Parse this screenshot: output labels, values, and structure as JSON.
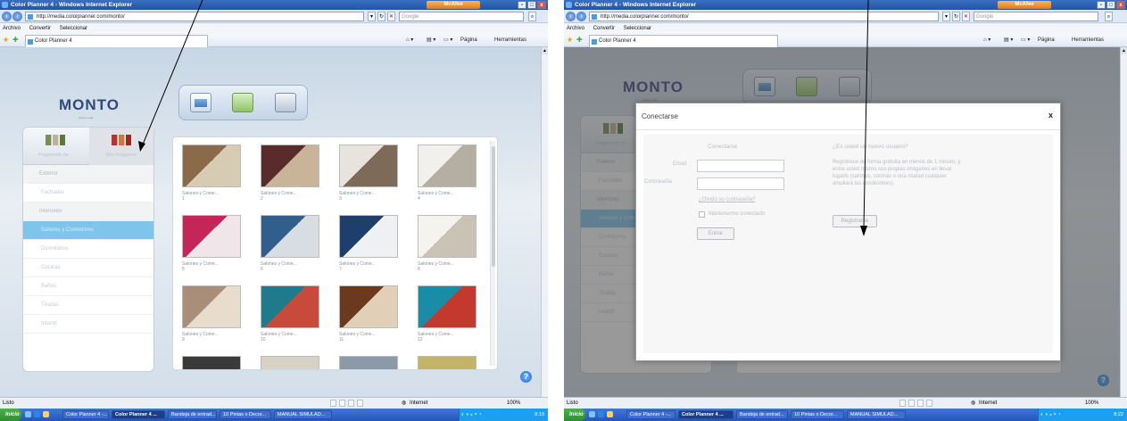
{
  "browser": {
    "window_title": "Color Planner 4 - Windows Internet Explorer",
    "mcafee_label": "McAfee",
    "url": "http://media.colorplanner.com/monto/",
    "search_placeholder": "Google",
    "menu": {
      "archivo": "Archivo",
      "convertir": "Convertir",
      "seleccionar": "Seleccionar"
    },
    "tab_title": "Color Planner 4",
    "tools": {
      "pagina": "Página",
      "herramientas": "Herramientas"
    },
    "status_left": "Listo",
    "status_zone": "Internet",
    "status_zoom": "100%",
    "window_buttons": {
      "minimize": "-",
      "maximize": "□",
      "close": "x"
    }
  },
  "taskbar": {
    "start_label": "Inicio",
    "items": [
      "Color Planner 4 -...",
      "Color Planner 4 ...",
      "Bandeja de entrad...",
      "10 Pintas o Decor...",
      "MANUAL SIMULAD..."
    ],
    "time_a": "8:19",
    "time_b": "8:22"
  },
  "app": {
    "logo": "MONTO",
    "logo_sub": "pinta tu vida",
    "sidebar_tabs": [
      "Fragmento de...",
      "Mis Imágenes"
    ],
    "sidebar_items": [
      {
        "label": "Exterior",
        "kind": "section"
      },
      {
        "label": "Fachadas",
        "kind": "item"
      },
      {
        "label": "Interiores",
        "kind": "section"
      },
      {
        "label": "Salones y Comedores",
        "kind": "selected"
      },
      {
        "label": "Dormitorios",
        "kind": "item"
      },
      {
        "label": "Cocinas",
        "kind": "item"
      },
      {
        "label": "Baños",
        "kind": "item"
      },
      {
        "label": "Tiradas",
        "kind": "item"
      },
      {
        "label": "Infantil",
        "kind": "item"
      }
    ],
    "gallery_captions": [
      "Salones y Come...\n1",
      "Salones y Come...\n2",
      "Salones y Come...\n3",
      "Salones y Come...\n4",
      "Salones y Come...\n5",
      "Salones y Come...\n6",
      "Salones y Come...\n7",
      "Salones y Come...\n8",
      "Salones y Come...\n9",
      "Salones y Come...\n10",
      "Salones y Come...\n11",
      "Salones y Come...\n12"
    ],
    "help_label": "?"
  },
  "dialog": {
    "title": "Conectarse",
    "close": "x",
    "login_heading": "Conectarse",
    "email_label": "Email",
    "password_label": "Contraseña",
    "forgot_link": "¿Olvidó su contraseña?",
    "remember_label": "Mantenerme conectado",
    "enter_button": "Entrar",
    "new_user_heading": "¿Es usted un nuevo usuario?",
    "new_user_text": "Regístrese de forma gratuita en menos de 1 minuto, y entre usted mismo sus propias imágenes en llevar lugarlo (salones, cocinas o una ciudad cualquier ampliará las condiciones).",
    "register_button": "Registrarse"
  },
  "colors": {
    "selected_item": "#7fc4ea",
    "titlebar": "#2f61b4",
    "overlay": "#555555"
  }
}
